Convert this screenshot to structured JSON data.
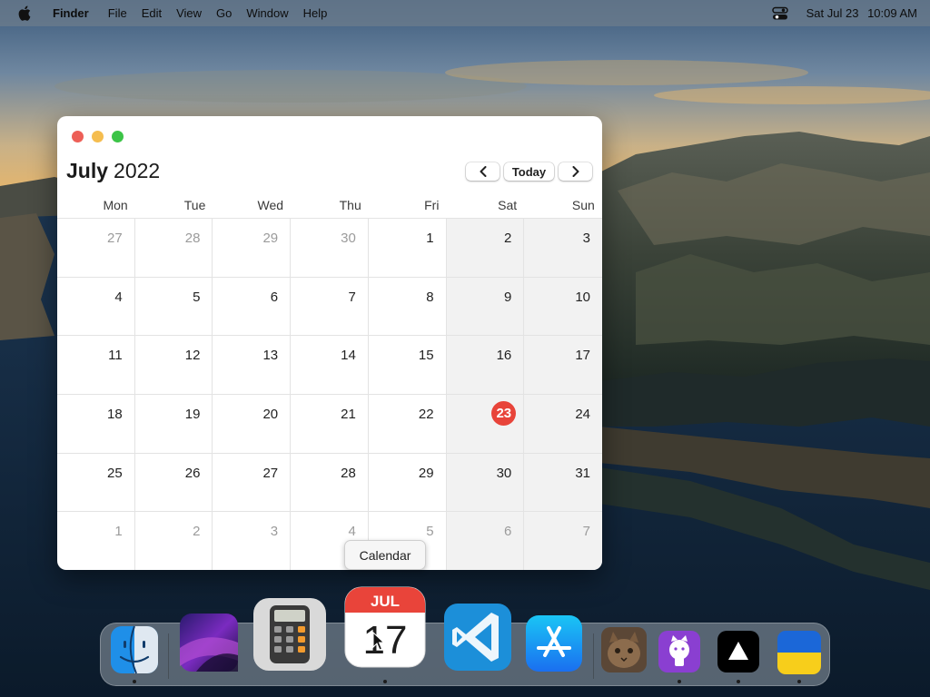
{
  "menubar": {
    "app_name": "Finder",
    "items": [
      "File",
      "Edit",
      "View",
      "Go",
      "Window",
      "Help"
    ],
    "date": "Sat Jul 23",
    "time": "10:09 AM"
  },
  "calendar": {
    "month": "July",
    "year": "2022",
    "today_label": "Today",
    "prev_icon": "chevron-left-icon",
    "next_icon": "chevron-right-icon",
    "weekdays": [
      "Mon",
      "Tue",
      "Wed",
      "Thu",
      "Fri",
      "Sat",
      "Sun"
    ],
    "days": [
      [
        "27",
        "28",
        "29",
        "30",
        "1",
        "2",
        "3"
      ],
      [
        "4",
        "5",
        "6",
        "7",
        "8",
        "9",
        "10"
      ],
      [
        "11",
        "12",
        "13",
        "14",
        "15",
        "16",
        "17"
      ],
      [
        "18",
        "19",
        "20",
        "21",
        "22",
        "23",
        "24"
      ],
      [
        "25",
        "26",
        "27",
        "28",
        "29",
        "30",
        "31"
      ],
      [
        "1",
        "2",
        "3",
        "4",
        "5",
        "6",
        "7"
      ]
    ],
    "muted": [
      [
        0,
        0
      ],
      [
        0,
        1
      ],
      [
        0,
        2
      ],
      [
        0,
        3
      ],
      [
        5,
        0
      ],
      [
        5,
        1
      ],
      [
        5,
        2
      ],
      [
        5,
        3
      ],
      [
        5,
        4
      ],
      [
        5,
        5
      ],
      [
        5,
        6
      ]
    ],
    "today": [
      3,
      5
    ],
    "today_color": "#e8443a"
  },
  "tooltip": {
    "label": "Calendar"
  },
  "dock": {
    "apps": [
      {
        "name": "finder",
        "icon": "finder-icon",
        "running": true
      },
      {
        "name": "macos-monterey",
        "icon": "monterey-wallpaper-icon",
        "running": false
      },
      {
        "name": "calculator",
        "icon": "calculator-icon",
        "running": false
      },
      {
        "name": "calendar",
        "icon": "calendar-icon",
        "running": true,
        "month": "JUL",
        "day": "17"
      },
      {
        "name": "vscode",
        "icon": "vscode-icon",
        "running": false
      },
      {
        "name": "app-store",
        "icon": "app-store-icon",
        "running": false
      },
      {
        "name": "cat-photo",
        "icon": "cat-photo-icon",
        "running": false
      },
      {
        "name": "github",
        "icon": "github-icon",
        "running": true
      },
      {
        "name": "vercel",
        "icon": "vercel-triangle-icon",
        "running": true
      },
      {
        "name": "ukraine-flag",
        "icon": "ukraine-flag-icon",
        "running": true
      }
    ]
  }
}
